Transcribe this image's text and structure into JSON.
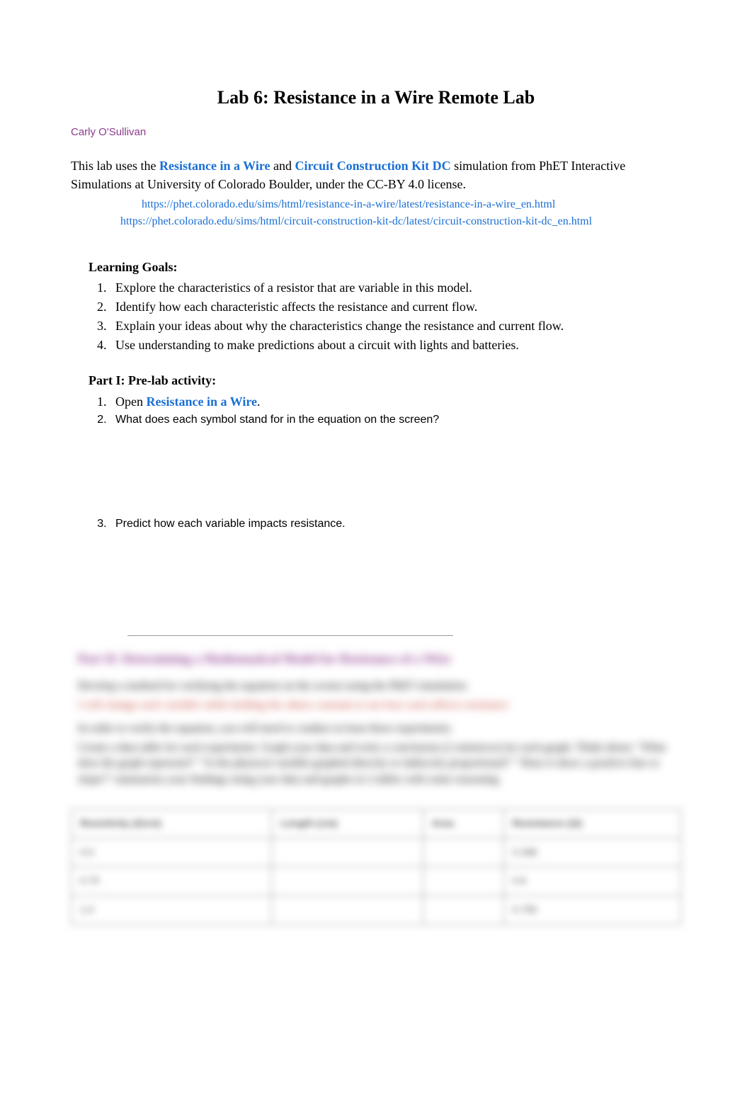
{
  "title": "Lab 6: Resistance in a Wire Remote Lab",
  "author": "Carly O'Sullivan",
  "intro": {
    "prefix": "This lab uses the ",
    "link1": "Resistance in a Wire",
    "mid": " and ",
    "link2": "Circuit Construction Kit DC",
    "suffix": " simulation from PhET Interactive Simulations at University of Colorado Boulder, under the CC-BY 4.0 license."
  },
  "urls": {
    "url1": "https://phet.colorado.edu/sims/html/resistance-in-a-wire/latest/resistance-in-a-wire_en.html",
    "url2": "https://phet.colorado.edu/sims/html/circuit-construction-kit-dc/latest/circuit-construction-kit-dc_en.html"
  },
  "learning_goals": {
    "heading": "Learning Goals:",
    "items": [
      "Explore the characteristics of a resistor that are variable in this model.",
      "Identify how each characteristic affects the resistance and current flow.",
      "Explain your ideas about why the characteristics change the resistance and current flow.",
      "Use understanding to make predictions about a circuit with lights and batteries."
    ]
  },
  "part1": {
    "heading": "Part I: Pre-lab activity:",
    "items": {
      "i1_prefix": "Open ",
      "i1_link": "Resistance in a Wire",
      "i1_suffix": ".",
      "i2": "What does each symbol stand for in the equation on the screen?",
      "i3": "Predict how each variable impacts resistance."
    }
  },
  "blurred": {
    "heading": "Part II: Determining a Mathematical Model for Resistance of a Wire",
    "line1": "Develop a method for verifying the equation on the screen using the PhET simulation.",
    "line2": "I will change each variable while holding the others constant to see how each affects resistance",
    "line3": "In order to verify the equation, you will need to conduct at least three experiments.",
    "line4": "Create a data table for each experiment. Graph your data and write a conclusion (2 sentences) for each graph. Think about: \"What does the graph represent?\" \"Is the physical variable graphed directly or indirectly proportional?\" \"Does it show a positive line or slope?\" summarize your findings using your data and graphs in 2 tables with some reasoning",
    "table": {
      "headers": [
        "Resistivity (Ωcm)",
        "Length (cm)",
        "Area",
        "Resistance (Ω)"
      ],
      "rows": [
        [
          "0.5",
          "",
          "",
          "0.398"
        ],
        [
          "0.75",
          "",
          "",
          "0.6"
        ],
        [
          "1.0",
          "",
          "",
          "0.795"
        ]
      ]
    }
  }
}
